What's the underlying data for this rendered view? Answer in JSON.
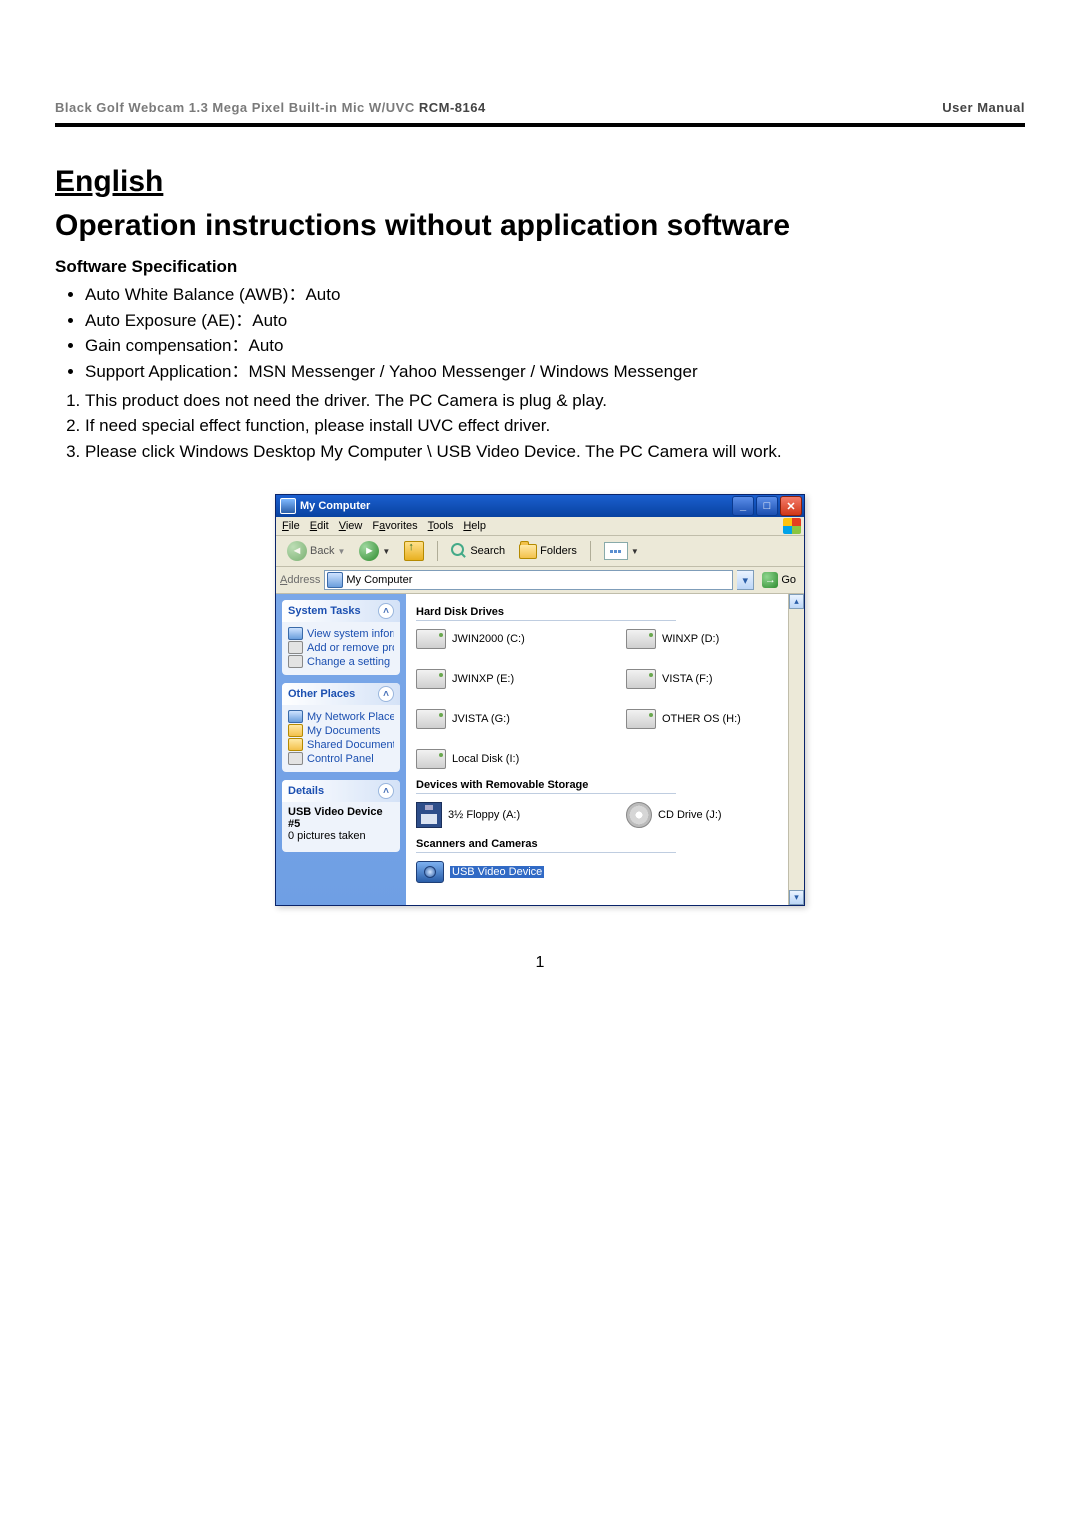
{
  "header": {
    "product": "Black Golf Webcam 1.3 Mega Pixel Built-in Mic W/UVC",
    "model": "RCM-8164",
    "right": "User Manual"
  },
  "lang": "English",
  "title": "Operation instructions without application software",
  "spec_heading": "Software Specification",
  "bullets": [
    "Auto White Balance (AWB)：Auto",
    "Auto Exposure (AE)：Auto",
    "Gain compensation：Auto",
    "Support Application：MSN Messenger / Yahoo Messenger / Windows Messenger"
  ],
  "steps": [
    "This product does not need the driver. The PC Camera is plug & play.",
    "If need special effect function, please install UVC effect driver.",
    "Please click Windows Desktop My Computer \\ USB Video Device. The PC Camera will work."
  ],
  "window": {
    "title": "My Computer",
    "menus": [
      "File",
      "Edit",
      "View",
      "Favorites",
      "Tools",
      "Help"
    ],
    "toolbar": {
      "back": "Back",
      "search": "Search",
      "folders": "Folders"
    },
    "address": {
      "label": "Address",
      "value": "My Computer",
      "go": "Go"
    },
    "panels": {
      "tasks": {
        "title": "System Tasks",
        "items": [
          "View system information",
          "Add or remove programs",
          "Change a setting"
        ]
      },
      "places": {
        "title": "Other Places",
        "items": [
          "My Network Places",
          "My Documents",
          "Shared Documents",
          "Control Panel"
        ]
      },
      "details": {
        "title": "Details",
        "line1": "USB Video Device #5",
        "line2": "0 pictures taken"
      }
    },
    "sections": {
      "hdd": {
        "title": "Hard Disk Drives",
        "drives": [
          "JWIN2000 (C:)",
          "WINXP (D:)",
          "JWINXP (E:)",
          "VISTA (F:)",
          "JVISTA (G:)",
          "OTHER OS (H:)",
          "Local Disk (I:)"
        ]
      },
      "removable": {
        "title": "Devices with Removable Storage",
        "drives": [
          "3½ Floppy (A:)",
          "CD Drive (J:)"
        ]
      },
      "scanners": {
        "title": "Scanners and Cameras",
        "drives": [
          "USB Video Device"
        ]
      }
    }
  },
  "page_number": "1"
}
